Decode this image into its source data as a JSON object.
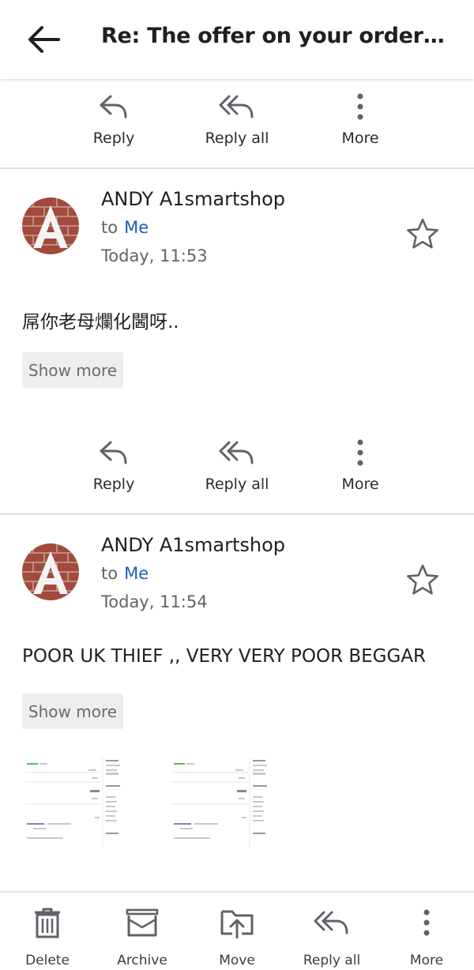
{
  "header": {
    "title": "Re: The offer on your order is a..."
  },
  "action_labels": {
    "reply": "Reply",
    "reply_all": "Reply all",
    "more": "More"
  },
  "messages": [
    {
      "sender": "ANDY A1smartshop",
      "to_prefix": "to",
      "to_name": "Me",
      "time": "Today, 11:53",
      "body": "屌你老母爛化閪呀..",
      "show_more": "Show more"
    },
    {
      "sender": "ANDY A1smartshop",
      "to_prefix": "to",
      "to_name": "Me",
      "time": "Today, 11:54",
      "body": "POOR UK THIEF ,, VERY VERY POOR BEGGAR",
      "show_more": "Show more"
    }
  ],
  "bottom_bar": {
    "delete": "Delete",
    "archive": "Archive",
    "move": "Move",
    "reply_all": "Reply all",
    "more": "More"
  },
  "icons": {
    "back": "arrow-left-icon",
    "reply": "reply-icon",
    "reply_all": "reply-all-icon",
    "more": "more-vertical-icon",
    "star": "star-outline-icon",
    "delete": "trash-icon",
    "archive": "archive-icon",
    "move": "move-icon"
  },
  "colors": {
    "link": "#1a5fb4",
    "icon": "#5f6368",
    "divider": "#dedede"
  }
}
